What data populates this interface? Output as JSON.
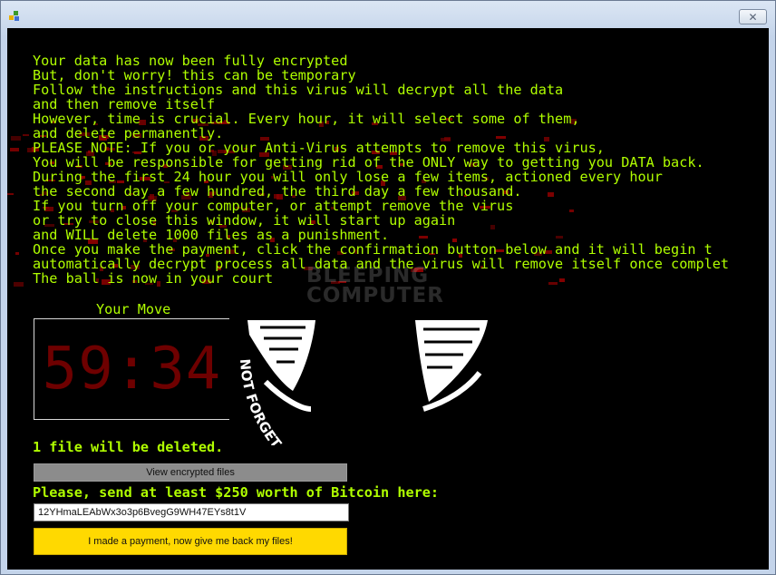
{
  "window": {
    "title": "",
    "close_glyph": "✕",
    "icon": "app-icon"
  },
  "message": {
    "lines": [
      "Your data has now been fully encrypted",
      "But, don't worry! this can be temporary",
      "Follow the instructions and this virus will decrypt all the data",
      "and then remove itself",
      "However, time is crucial. Every hour, it will select some of them,",
      "and delete permanently.",
      "PLEASE NOTE: If you or your Anti-Virus attempts to remove this virus,",
      "You will be responsible for getting rid of the ONLY way to getting you DATA back.",
      "During the first 24 hour you will only lose a few items, actioned every hour",
      "the second day a few hundred, the third day a few thousand.",
      "If you turn off your computer, or attempt remove the virus",
      "or try to close this window, it will start up again",
      "and WILL delete 1000 files as a punishment.",
      "Once you make the payment, click the confirmation button below and it will begin t",
      "automatically decrypt process all data and the virus will remove itself once complet",
      "The ball is now in your court"
    ]
  },
  "watermark": {
    "line1": "BLEEPING",
    "line2": "COMPUTER"
  },
  "timer": {
    "label": "Your Move",
    "value": "59:34"
  },
  "emblem": {
    "motto": "NOT FORGET WE DO NOT FORGIVE EXPECT"
  },
  "status": {
    "files_deleted": "1 file will be deleted."
  },
  "buttons": {
    "view_files": "View encrypted files",
    "confirm_payment": "I made a payment, now give me back my files!"
  },
  "payment": {
    "label": "Please, send at least $250 worth of Bitcoin here:",
    "address": "12YHmaLEAbWx3o3p6BvegG9WH47EYs8t1V"
  },
  "colors": {
    "text_green": "#b0ff00",
    "timer_red": "#6e0000",
    "pay_yellow": "#ffd900",
    "noise_red": "#8a0000"
  }
}
